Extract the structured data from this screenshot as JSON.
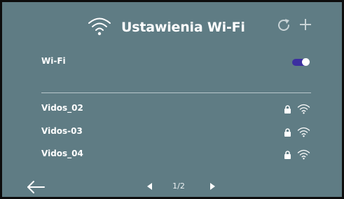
{
  "header": {
    "title": "Ustawienia Wi-Fi",
    "icons": [
      "wifi-icon",
      "refresh-icon",
      "add-icon"
    ]
  },
  "wifi_setting": {
    "label": "Wi-Fi",
    "enabled": true,
    "toggle_color": "#3c2fa0"
  },
  "networks": [
    {
      "name": "Vidos_02",
      "secured": true,
      "icons": [
        "lock-icon",
        "wifi-signal-icon"
      ]
    },
    {
      "name": "Vidos-03",
      "secured": true,
      "icons": [
        "lock-icon",
        "wifi-signal-icon"
      ]
    },
    {
      "name": "Vidos_04",
      "secured": true,
      "icons": [
        "lock-icon",
        "wifi-signal-icon"
      ]
    }
  ],
  "pagination": {
    "indicator": "1/2",
    "icons": [
      "back-arrow-icon",
      "prev-page-icon",
      "next-page-icon"
    ]
  },
  "colors": {
    "background": "#5f7c84",
    "text": "#ffffff",
    "divider": "#b9c7cb",
    "frame": "#0d0d0d"
  }
}
